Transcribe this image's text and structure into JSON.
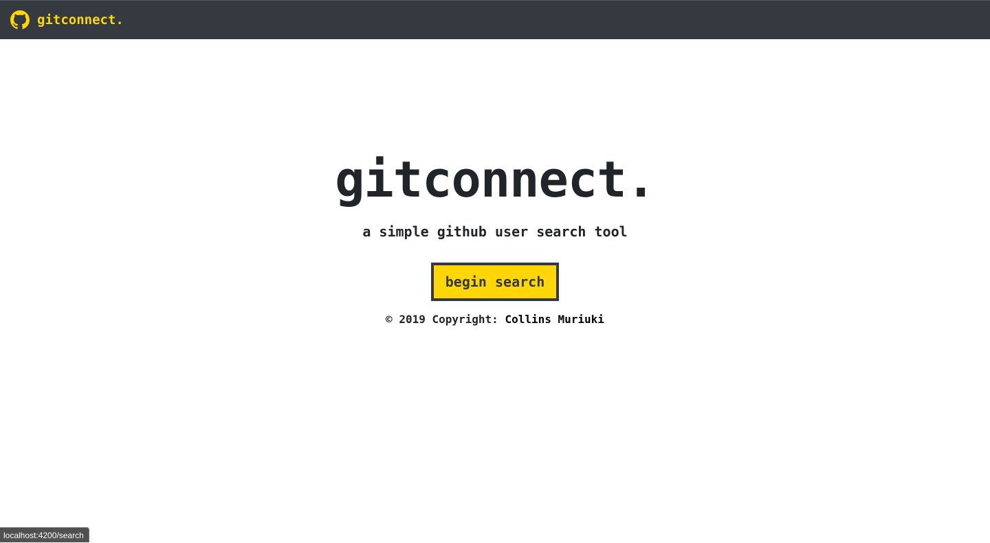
{
  "navbar": {
    "brand_icon": "github-icon",
    "brand_label": "gitconnect.",
    "background_color": "#343a40",
    "accent_color": "#ffd60a"
  },
  "hero": {
    "title": "gitconnect.",
    "subtitle": "a simple github user search tool",
    "button_label": "begin search",
    "copyright_prefix": "© 2019 Copyright: ",
    "copyright_author": "Collins Muriuki"
  },
  "status_bar": {
    "url": "localhost:4200/search"
  }
}
